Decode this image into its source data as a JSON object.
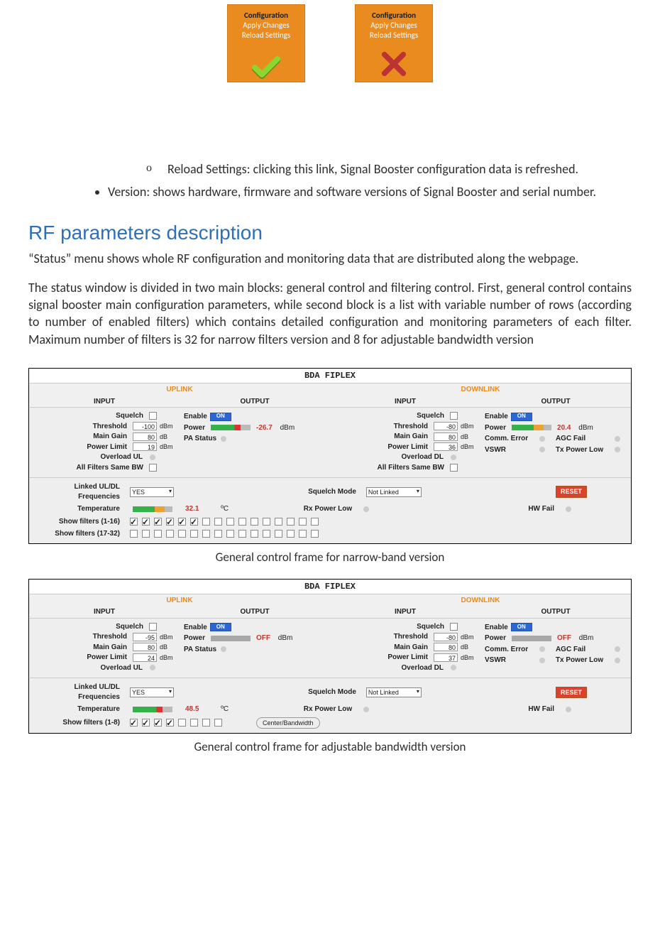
{
  "thumbs": {
    "title": "Configuration",
    "line1": "Apply Changes",
    "line2": "Reload Settings"
  },
  "content": {
    "reload_label": "Reload Settings:",
    "reload_text": "clicking this link, Signal Booster configuration data is refreshed.",
    "version_text": "Version: shows hardware, firmware and software versions of Signal Booster and serial number.",
    "heading": "RF parameters description",
    "para1": "“Status” menu shows whole RF configuration and monitoring data that are distributed along the webpage.",
    "para2": "The status window is divided in two main blocks: general control and filtering control. First, general control contains signal booster main configuration parameters, while second block is a list with variable number of rows (according to number of enabled filters) which contains detailed configuration and monitoring parameters of each filter. Maximum number of filters is 32 for narrow filters version and 8 for adjustable bandwidth version"
  },
  "captions": {
    "narrow": "General control frame for narrow-band version",
    "adjustable": "General control frame for adjustable bandwidth version"
  },
  "panel_common": {
    "title": "BDA FIPLEX",
    "uplink": "UPLINK",
    "downlink": "DOWNLINK",
    "input": "INPUT",
    "output": "OUTPUT",
    "labels": {
      "squelch": "Squelch",
      "threshold": "Threshold",
      "main_gain": "Main Gain",
      "power_limit": "Power Limit",
      "overload_ul": "Overload UL",
      "overload_dl": "Overload DL",
      "all_filters": "All Filters Same BW",
      "enable": "Enable",
      "power": "Power",
      "pa_status": "PA Status",
      "comm_error": "Comm. Error",
      "vswr": "VSWR",
      "agc_fail": "AGC Fail",
      "tx_power_low": "Tx Power Low",
      "linked_freq": "Linked UL/DL\nFrequencies",
      "squelch_mode": "Squelch Mode",
      "temperature": "Temperature",
      "rx_power_low": "Rx Power Low",
      "hw_fail": "HW Fail",
      "show_filters_1_16": "Show filters (1-16)",
      "show_filters_17_32": "Show filters (17-32)",
      "show_filters_1_8": "Show filters (1-8)",
      "reset": "RESET",
      "center_bw": "Center/Bandwidth",
      "on": "ON",
      "off": "OFF",
      "yes": "YES",
      "not_linked": "Not Linked"
    },
    "units": {
      "db": "dB",
      "dbm": "dBm",
      "c": "ºC"
    }
  },
  "narrow": {
    "ul": {
      "threshold": "-100",
      "gain": "80",
      "power_limit": "19"
    },
    "ul_out": {
      "power": "-26.7"
    },
    "dl": {
      "threshold": "-80",
      "gain": "80",
      "power_limit": "36"
    },
    "dl_out": {
      "power": "20.4"
    },
    "temperature": "32.1",
    "filters_1_16": [
      true,
      true,
      true,
      true,
      true,
      true,
      false,
      false,
      false,
      false,
      false,
      false,
      false,
      false,
      false,
      false
    ],
    "filters_17_32": [
      false,
      false,
      false,
      false,
      false,
      false,
      false,
      false,
      false,
      false,
      false,
      false,
      false,
      false,
      false,
      false
    ]
  },
  "adjustable": {
    "ul": {
      "threshold": "-95",
      "gain": "80",
      "power_limit": "24"
    },
    "ul_out": {
      "power_state": "OFF"
    },
    "dl": {
      "threshold": "-80",
      "gain": "80",
      "power_limit": "37"
    },
    "dl_out": {
      "power_state": "OFF"
    },
    "temperature": "48.5",
    "filters_1_8": [
      true,
      true,
      true,
      true,
      false,
      false,
      false,
      false
    ]
  }
}
